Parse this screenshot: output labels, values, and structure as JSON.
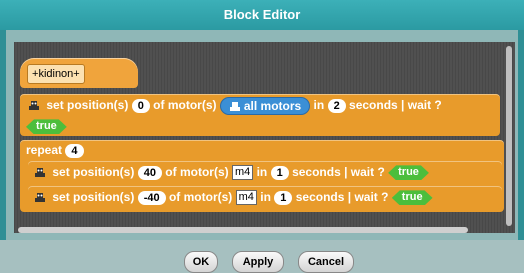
{
  "window": {
    "title": "Block Editor"
  },
  "hat": {
    "label": "kidinon",
    "plus_left": "+",
    "plus_right": "+"
  },
  "block1": {
    "prefix": "set position(s)",
    "position": "0",
    "mid": "of motor(s)",
    "motor": "all motors",
    "in_label": "in",
    "seconds": "2",
    "suffix": "seconds | wait ?",
    "wait": "true"
  },
  "repeat": {
    "label": "repeat",
    "count": "4"
  },
  "inner1": {
    "prefix": "set position(s)",
    "position": "40",
    "mid": "of motor(s)",
    "motor": "m4",
    "in_label": "in",
    "seconds": "1",
    "suffix": "seconds | wait ?",
    "wait": "true"
  },
  "inner2": {
    "prefix": "set position(s)",
    "position": "-40",
    "mid": "of motor(s)",
    "motor": "m4",
    "in_label": "in",
    "seconds": "1",
    "suffix": "seconds | wait ?",
    "wait": "true"
  },
  "buttons": {
    "ok": "OK",
    "apply": "Apply",
    "cancel": "Cancel"
  },
  "colors": {
    "control": "#e89b2b",
    "boolean": "#4cbe3c",
    "motor_pill": "#3b8fd6",
    "title_bar": "#3cb0b8"
  },
  "icons": {
    "robot": "robot-icon"
  }
}
